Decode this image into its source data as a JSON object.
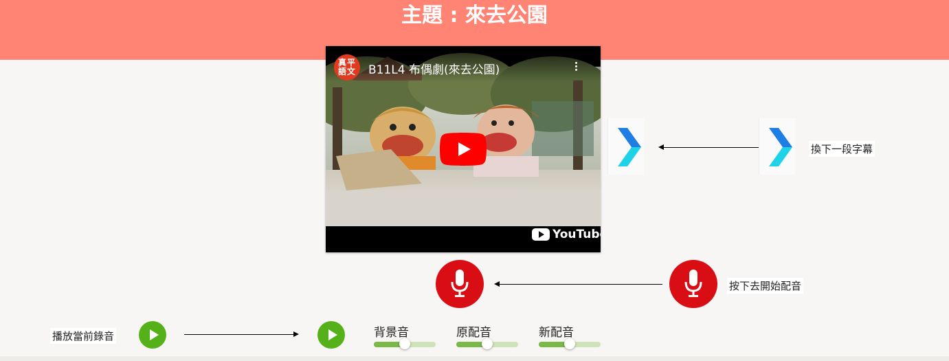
{
  "header": {
    "title": "主題 : 來去公園"
  },
  "video": {
    "channel_logo_text": "真平語文",
    "title": "B11L4 布偶劇(來去公園)",
    "brand": "YouTube"
  },
  "subtitle_control": {
    "label": "換下一段字幕"
  },
  "record_control": {
    "label": "按下去開始配音"
  },
  "playback": {
    "label": "播放當前錄音"
  },
  "sliders": [
    {
      "label": "背景音",
      "value": 0.5
    },
    {
      "label": "原配音",
      "value": 0.5
    },
    {
      "label": "新配音",
      "value": 0.5
    }
  ],
  "colors": {
    "header_bg": "#ff8474",
    "mic_red": "#d90e14",
    "play_green": "#55b11a",
    "slider_fill": "#7ab848"
  }
}
